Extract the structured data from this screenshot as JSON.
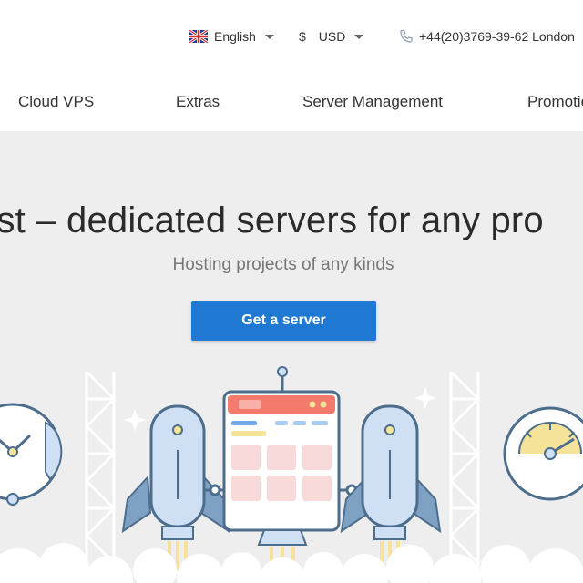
{
  "topbar": {
    "language_label": "English",
    "currency_symbol": "$",
    "currency_label": "USD",
    "phone_label": "+44(20)3769-39-62 London"
  },
  "nav": {
    "items": [
      {
        "label": "Cloud VPS"
      },
      {
        "label": "Extras"
      },
      {
        "label": "Server Management"
      },
      {
        "label": "Promotio"
      }
    ]
  },
  "hero": {
    "title": "ost – dedicated servers for any pro",
    "subtitle": "Hosting projects of any kinds",
    "cta_label": "Get a server"
  },
  "colors": {
    "accent": "#1f78d1",
    "hero_bg": "#eeeeee",
    "illustration_blue": "#cfe0f5",
    "illustration_outline": "#4d6d8c",
    "panel_header": "#f47a6b",
    "panel_cells": "#f8dadb",
    "gauge_yellow": "#f6e39a"
  },
  "icons": [
    "uk-flag-icon",
    "dollar-icon",
    "phone-icon",
    "chevron-down-icon"
  ]
}
